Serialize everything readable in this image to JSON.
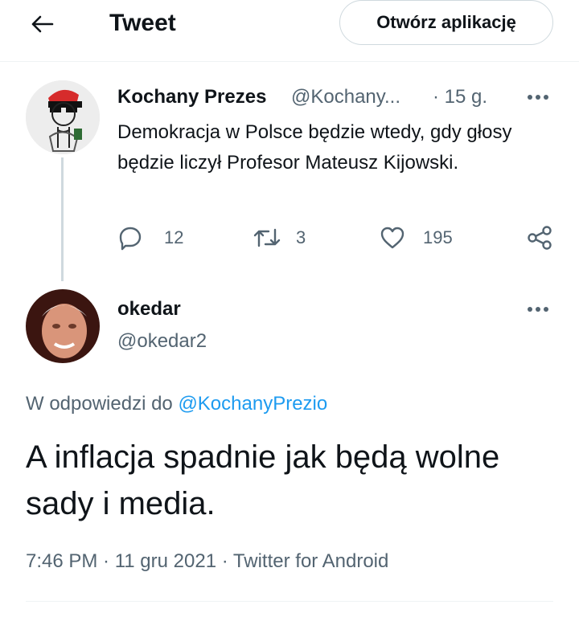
{
  "header": {
    "back_icon": "arrow-left-icon",
    "title": "Tweet",
    "open_app_label": "Otwórz aplikację"
  },
  "parent_tweet": {
    "author_name": "Kochany Prezes",
    "author_handle": "@Kochany...",
    "time": "· 15 g.",
    "text": "Demokracja w Polsce będzie wtedy, gdy głosy będzie liczył Profesor Mateusz Kijowski.",
    "replies": "12",
    "retweets": "3",
    "likes": "195",
    "more_icon": "more-horizontal-icon"
  },
  "main_tweet": {
    "author_name": "okedar",
    "author_handle": "@okedar2",
    "reply_prefix": "W odpowiedzi do",
    "reply_mention": "@KochanyPrezio",
    "text": "A inflacja spadnie jak będą wolne sady i media.",
    "meta": "7:46 PM · 11 gru 2021 · Twitter for Android",
    "more_icon": "more-horizontal-icon"
  },
  "colors": {
    "text": "#0f1419",
    "secondary": "#536471",
    "accent": "#1d9bf0",
    "border": "#cfd9de"
  }
}
